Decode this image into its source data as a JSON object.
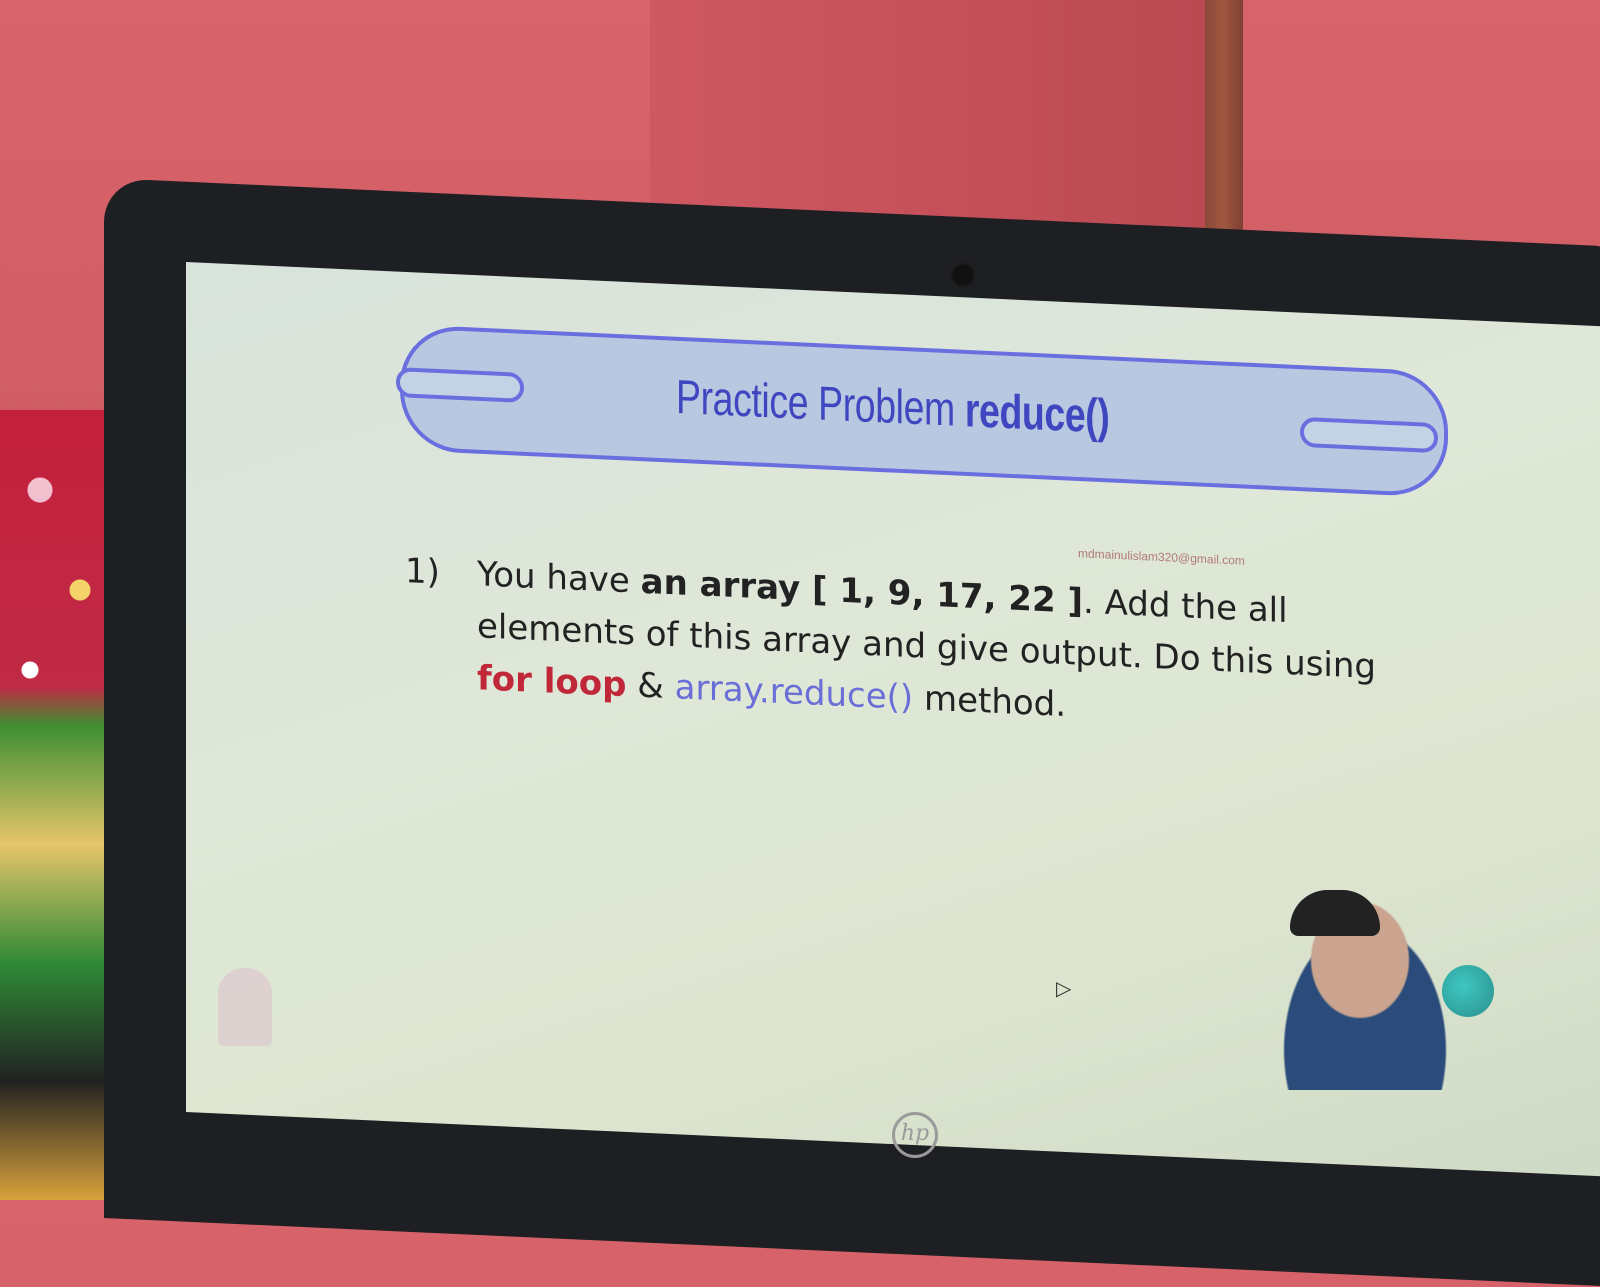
{
  "slide": {
    "title_regular": "Practice Problem ",
    "title_bold": "reduce()",
    "watermark_email": "mdmainulislam320@gmail.com",
    "problem_number": "1)",
    "problem_text_1": "You have ",
    "problem_text_2": "an array",
    "problem_text_3": " [ 1, 9, 17, 22 ]",
    "problem_text_4": ". Add the all elements of this array and give output. Do this using ",
    "for_loop": "for loop",
    "amp": " & ",
    "array_reduce": "array.reduce()",
    "method": " method."
  },
  "device": {
    "brand_logo": "hp"
  },
  "colors": {
    "title_blue": "#4046c0",
    "cloud_fill": "#b8c8e0",
    "cloud_outline": "#6a6fe0",
    "keyword_red": "#c0283a",
    "keyword_blue": "#6a6fd8"
  }
}
